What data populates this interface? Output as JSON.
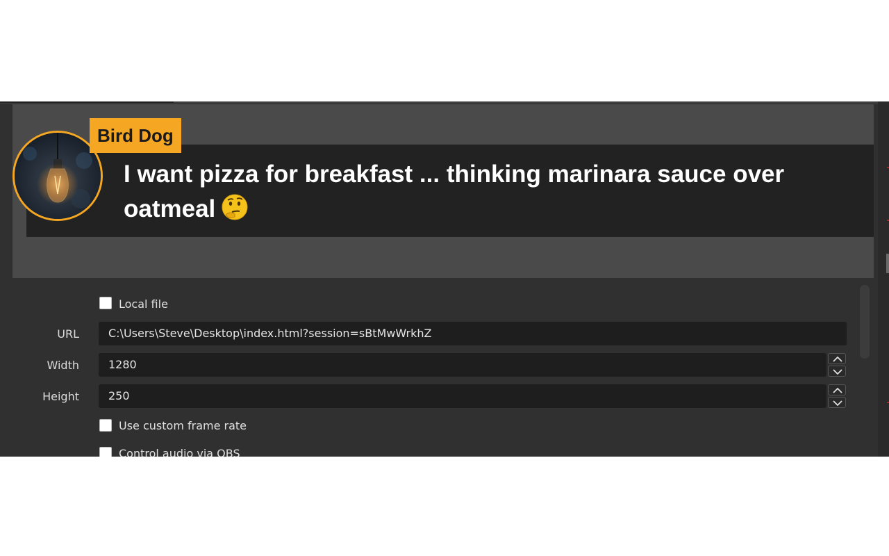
{
  "preview": {
    "name_tag": "Bird Dog",
    "message_line1": "I want pizza for breakfast ... thinking marinara sauce over",
    "message_line2": "oatmeal",
    "emoji": "thinking-face-icon",
    "accent_color": "#f5a623"
  },
  "settings": {
    "local_file_label": "Local file",
    "local_file_checked": false,
    "url_label": "URL",
    "url_value": "C:\\Users\\Steve\\Desktop\\index.html?session=sBtMwWrkhZ",
    "width_label": "Width",
    "width_value": "1280",
    "height_label": "Height",
    "height_value": "250",
    "custom_frame_rate_label": "Use custom frame rate",
    "custom_frame_rate_checked": false,
    "control_audio_label": "Control audio via OBS",
    "control_audio_checked": false
  }
}
